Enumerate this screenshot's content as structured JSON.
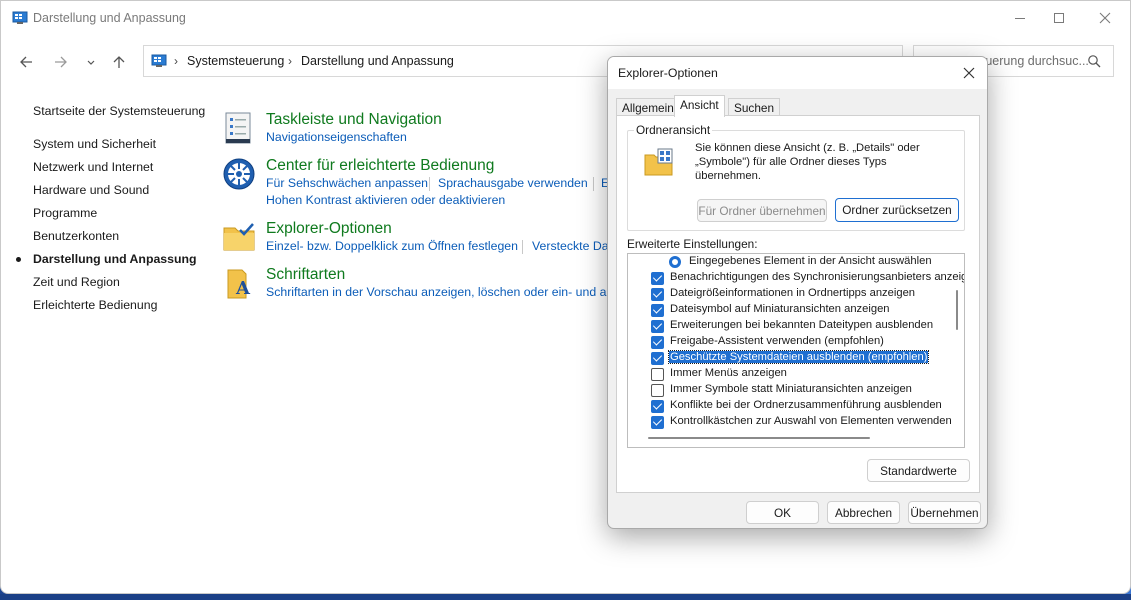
{
  "window": {
    "title": "Darstellung und Anpassung"
  },
  "address": {
    "crumbs": [
      "Systemsteuerung",
      "Darstellung und Anpassung"
    ],
    "search_placeholder": "Systemsteuerung durchsuc..."
  },
  "sidebar": {
    "items": [
      {
        "label": "Startseite der Systemsteuerung"
      },
      {
        "label": "System und Sicherheit"
      },
      {
        "label": "Netzwerk und Internet"
      },
      {
        "label": "Hardware und Sound"
      },
      {
        "label": "Programme"
      },
      {
        "label": "Benutzerkonten"
      },
      {
        "label": "Darstellung und Anpassung",
        "active": true
      },
      {
        "label": "Zeit und Region"
      },
      {
        "label": "Erleichterte Bedienung"
      }
    ]
  },
  "categories": [
    {
      "title": "Taskleiste und Navigation",
      "links": [
        "Navigationseigenschaften"
      ]
    },
    {
      "title": "Center für erleichterte Bedienung",
      "links": [
        "Für Sehschwächen anpassen",
        "Sprachausgabe verwenden",
        "E",
        "Hohen Kontrast aktivieren oder deaktivieren"
      ]
    },
    {
      "title": "Explorer-Optionen",
      "links": [
        "Einzel- bzw. Doppelklick zum Öffnen festlegen",
        "Versteckte Date"
      ]
    },
    {
      "title": "Schriftarten",
      "links": [
        "Schriftarten in der Vorschau anzeigen, löschen oder ein- und ausb"
      ]
    }
  ],
  "dialog": {
    "title": "Explorer-Optionen",
    "tabs": [
      "Allgemein",
      "Ansicht",
      "Suchen"
    ],
    "active_tab": "Ansicht",
    "folder_view": {
      "legend": "Ordneransicht",
      "description": "Sie können diese Ansicht (z. B. „Details\" oder „Symbole\") für alle Ordner dieses Typs übernehmen.",
      "apply_button": "Für Ordner übernehmen",
      "reset_button": "Ordner zurücksetzen"
    },
    "advanced_label": "Erweiterte Einstellungen:",
    "advanced_items": [
      {
        "label": "Eingegebenes Element in der Ansicht auswählen",
        "type": "radio",
        "checked": true
      },
      {
        "label": "Benachrichtigungen des Synchronisierungsanbieters anzeig",
        "type": "checkbox",
        "checked": true
      },
      {
        "label": "Dateigrößeinformationen in Ordnertipps anzeigen",
        "type": "checkbox",
        "checked": true
      },
      {
        "label": "Dateisymbol auf Miniaturansichten anzeigen",
        "type": "checkbox",
        "checked": true
      },
      {
        "label": "Erweiterungen bei bekannten Dateitypen ausblenden",
        "type": "checkbox",
        "checked": true
      },
      {
        "label": "Freigabe-Assistent verwenden (empfohlen)",
        "type": "checkbox",
        "checked": true
      },
      {
        "label": "Geschützte Systemdateien ausblenden (empfohlen)",
        "type": "checkbox",
        "checked": true,
        "selected": true
      },
      {
        "label": "Immer Menüs anzeigen",
        "type": "checkbox",
        "checked": false
      },
      {
        "label": "Immer Symbole statt Miniaturansichten anzeigen",
        "type": "checkbox",
        "checked": false
      },
      {
        "label": "Konflikte bei der Ordnerzusammenführung ausblenden",
        "type": "checkbox",
        "checked": true
      },
      {
        "label": "Kontrollkästchen zur Auswahl von Elementen verwenden",
        "type": "checkbox",
        "checked": true
      }
    ],
    "defaults_button": "Standardwerte",
    "ok_button": "OK",
    "cancel_button": "Abbrechen",
    "apply_button": "Übernehmen"
  }
}
